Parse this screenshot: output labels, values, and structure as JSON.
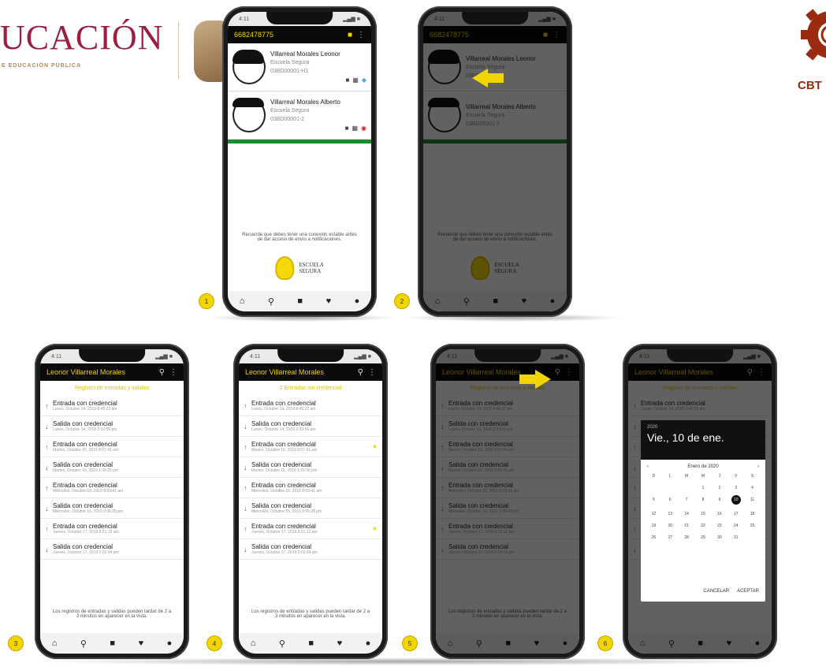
{
  "header": {
    "logo_text": "UCACIÓN",
    "logo_sub": "E EDUCACIÓN PÚBLICA",
    "right_logo": "CBT"
  },
  "phone1": {
    "status_time": "4:11",
    "status_right": "▂▄▆ ■",
    "appbar_title": "6682478775",
    "contacts": [
      {
        "name": "Villarreal Morales Leonor",
        "school": "Escuela Segura",
        "code": "03BD00001-H1"
      },
      {
        "name": "Villarreal Morales Alberto",
        "school": "Escuela Segura",
        "code": "03BD00001-2"
      }
    ],
    "note": "Recuerde que debes tener una conexión estable antes de dar acceso de envío a notificaciones.",
    "brand_line1": "ESCUELA",
    "brand_line2": "SEGURA",
    "badge": "1"
  },
  "phone2": {
    "badge": "2"
  },
  "phone3": {
    "title": "Leonor Villarreal Morales",
    "subtitle": "Registro de entradas y salidas",
    "records": [
      {
        "type": "in",
        "label": "Entrada con credencial",
        "date": "Lunes, Octubre 14, 2019 8:45:22 am"
      },
      {
        "type": "out",
        "label": "Salida con credencial",
        "date": "Lunes, Octubre 14, 2019 2:33:56 pm"
      },
      {
        "type": "in",
        "label": "Entrada con credencial",
        "date": "Martes, Octubre 15, 2019 8:57:41 am"
      },
      {
        "type": "out",
        "label": "Salida con credencial",
        "date": "Martes, Octubre 15, 2019 1:20:35 pm"
      },
      {
        "type": "in",
        "label": "Entrada con credencial",
        "date": "Miércoles, Octubre 16, 2019 8:59:41 am"
      },
      {
        "type": "out",
        "label": "Salida con credencial",
        "date": "Miércoles, Octubre 16, 2019 2:06:28 pm"
      },
      {
        "type": "in",
        "label": "Entrada con credencial",
        "date": "Jueves, Octubre 17, 2019 8:51:12 am"
      },
      {
        "type": "out",
        "label": "Salida con credencial",
        "date": "Jueves, Octubre 17, 2019 2:01:04 pm"
      }
    ],
    "footer": "Los registros de entradas y salidas pueden tardar de 2 a 3 minutos en aparecer en la vista.",
    "badge": "3"
  },
  "phone4": {
    "title": "Leonor Villarreal Morales",
    "subtitle": "2 Entradas sin credencial",
    "badge": "4"
  },
  "phone5": {
    "badge": "5"
  },
  "phone6": {
    "dialog_year": "2020",
    "dialog_date": "Vie., 10 de ene.",
    "month_label": "Enero de 2020",
    "weekdays": [
      "D",
      "L",
      "M",
      "M",
      "J",
      "V",
      "S"
    ],
    "days": [
      "",
      "",
      "",
      "1",
      "2",
      "3",
      "4",
      "5",
      "6",
      "7",
      "8",
      "9",
      "10",
      "11",
      "12",
      "13",
      "14",
      "15",
      "16",
      "17",
      "18",
      "19",
      "20",
      "21",
      "22",
      "23",
      "24",
      "25",
      "26",
      "27",
      "28",
      "29",
      "30",
      "31"
    ],
    "selected_day": "10",
    "cancel": "CANCELAR",
    "accept": "ACEPTAR",
    "badge": "6"
  },
  "icons": {
    "home": "home-icon",
    "search": "search-icon",
    "app": "app-icon",
    "heart": "heart-icon",
    "dot": "dot-icon"
  }
}
